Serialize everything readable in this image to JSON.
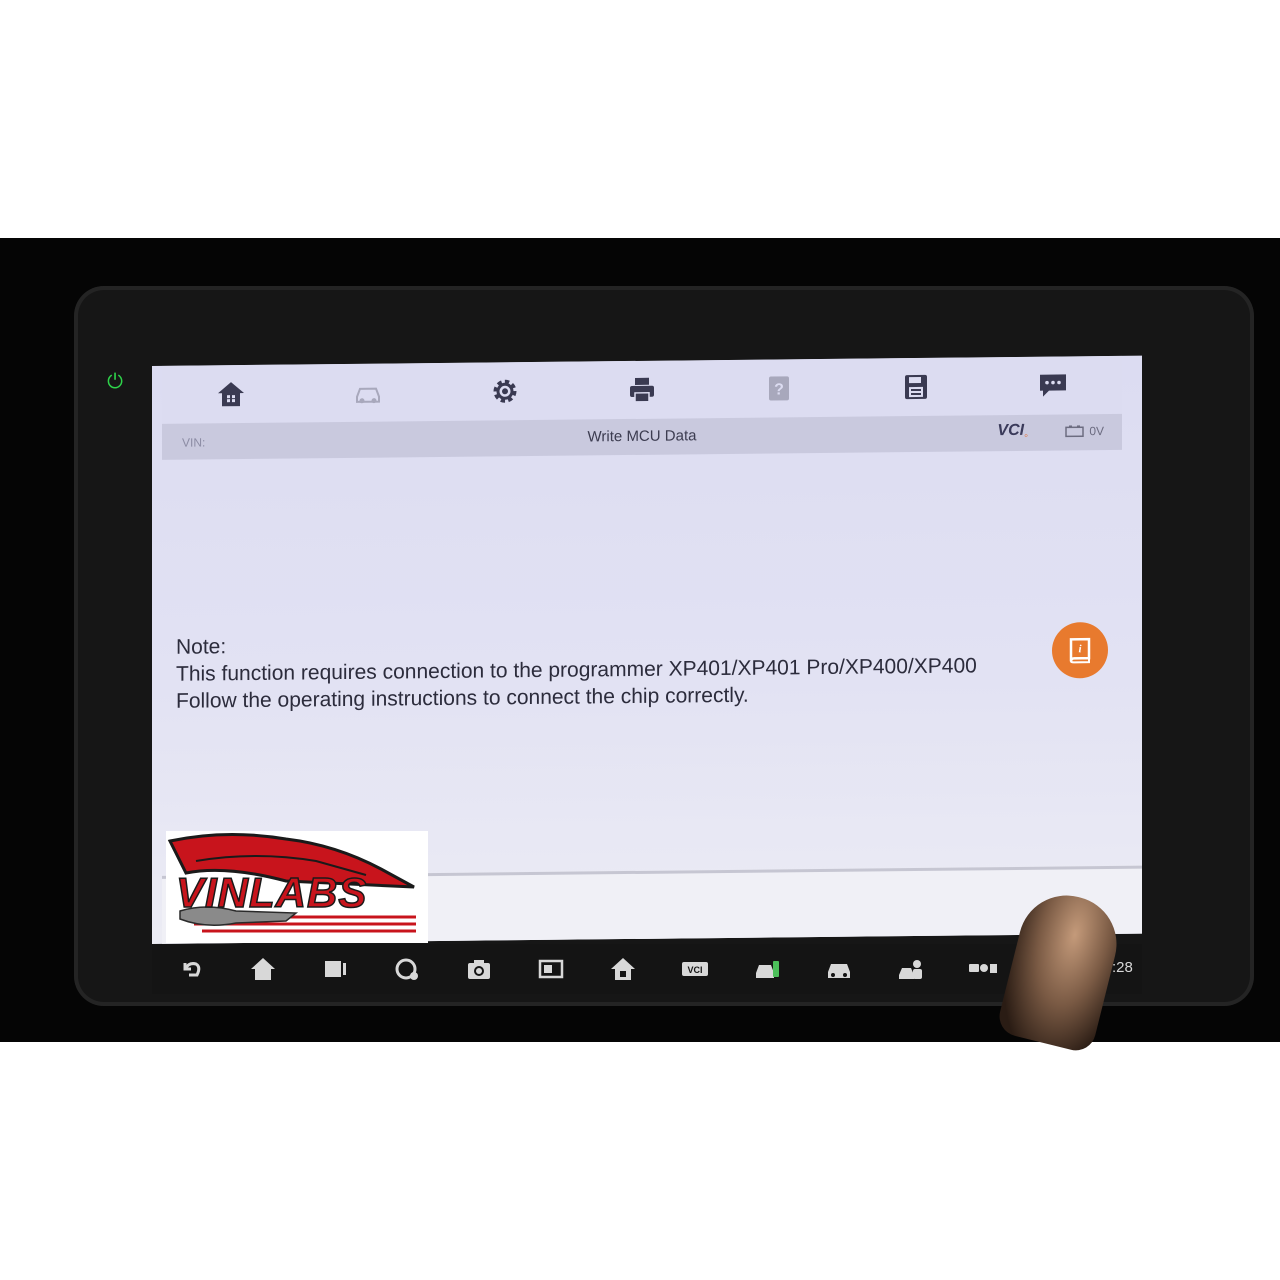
{
  "toolbar": {
    "buttons": [
      "home-icon",
      "vehicle-swap-icon",
      "gear-icon",
      "printer-icon",
      "help-icon",
      "save-icon",
      "message-icon"
    ]
  },
  "title_bar": {
    "vin_label": "VIN:",
    "title": "Write MCU Data",
    "vci_label": "VCI",
    "voltage": "0V"
  },
  "note": {
    "heading": "Note:",
    "line1": "This function requires connection to the programmer XP401/XP401 Pro/XP400/XP400",
    "line2": "Follow the operating instructions to connect the chip correctly."
  },
  "nav_bar": {
    "icons": [
      "back-icon",
      "home-icon",
      "recent-apps-icon",
      "browser-icon",
      "camera-icon",
      "screenshot-icon",
      "home-alt-icon",
      "vci-icon",
      "vehicle-diagnosis-icon",
      "car-icon",
      "technician-icon",
      "status-icons"
    ],
    "clock": ":28"
  },
  "watermark": {
    "text": "VINLABS"
  },
  "colors": {
    "accent": "#e87a2e",
    "power_led": "#2ed34a",
    "logo_red": "#c8141c"
  }
}
